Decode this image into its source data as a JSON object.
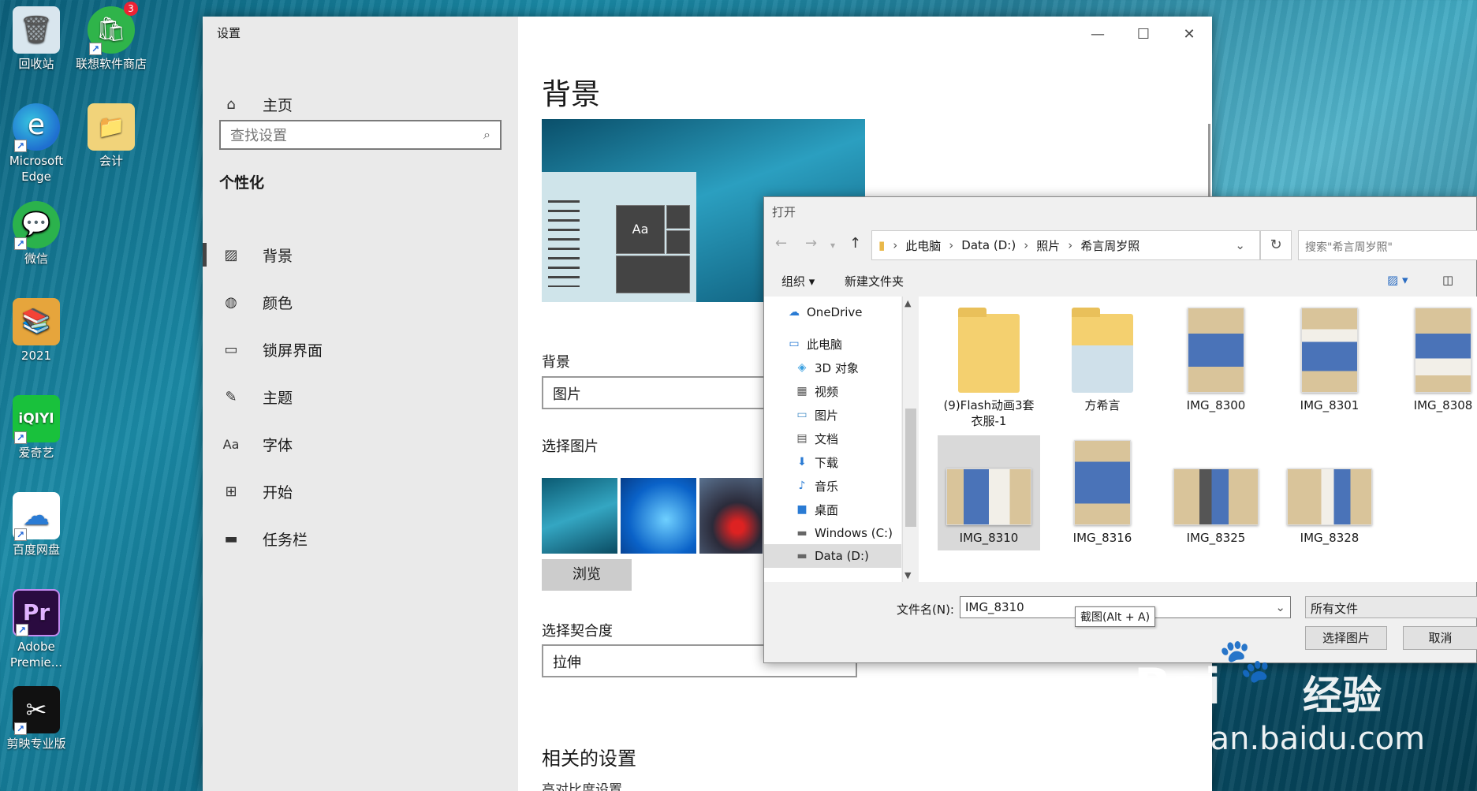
{
  "desktop": {
    "icons": [
      {
        "label": "回收站",
        "glyph": "🗑",
        "bg": "#d9e6ee"
      },
      {
        "label": "联想软件商店",
        "glyph": "🛍",
        "bg": "#2fb44a",
        "badge": "3"
      },
      {
        "label": "Microsoft Edge",
        "glyph": "e",
        "bg": "#1f8fd6"
      },
      {
        "label": "会计",
        "glyph": "📁",
        "bg": "#f1d37a"
      },
      {
        "label": "微信",
        "glyph": "💬",
        "bg": "#2bb24c"
      },
      {
        "label": "2021",
        "glyph": "📚",
        "bg": "#e6a53c"
      },
      {
        "label": "爱奇艺",
        "glyph": "iQIYI",
        "bg": "#19c13c"
      },
      {
        "label": "百度网盘",
        "glyph": "☁",
        "bg": "#ffffff"
      },
      {
        "label": "Adobe Premie...",
        "glyph": "Pr",
        "bg": "#2a0b40"
      },
      {
        "label": "剪映专业版",
        "glyph": "✂",
        "bg": "#111111"
      }
    ]
  },
  "settings": {
    "title": "设置",
    "home": "主页",
    "search_placeholder": "查找设置",
    "section": "个性化",
    "nav": [
      "背景",
      "颜色",
      "锁屏界面",
      "主题",
      "字体",
      "开始",
      "任务栏"
    ],
    "page_title": "背景",
    "preview_tile": "Aa",
    "background_label": "背景",
    "background_value": "图片",
    "choose_picture_label": "选择图片",
    "browse": "浏览",
    "fit_label": "选择契合度",
    "fit_value": "拉伸",
    "related_title": "相关的设置",
    "related_link": "高对比度设置"
  },
  "dialog": {
    "title": "打开",
    "breadcrumb": [
      "此电脑",
      "Data (D:)",
      "照片",
      "希言周岁照"
    ],
    "search_placeholder": "搜索\"希言周岁照\"",
    "organize": "组织 ▾",
    "new_folder": "新建文件夹",
    "tree": [
      {
        "label": "OneDrive",
        "icon": "☁",
        "color": "#2a7bd4"
      },
      {
        "label": "此电脑",
        "icon": "💻",
        "color": "#2a7bd4"
      },
      {
        "label": "3D 对象",
        "icon": "◈",
        "color": "#3aa0e0"
      },
      {
        "label": "视频",
        "icon": "▦",
        "color": "#555"
      },
      {
        "label": "图片",
        "icon": "▭",
        "color": "#4a90c8"
      },
      {
        "label": "文档",
        "icon": "▤",
        "color": "#555"
      },
      {
        "label": "下载",
        "icon": "⬇",
        "color": "#2a7bd4"
      },
      {
        "label": "音乐",
        "icon": "♪",
        "color": "#2a7bd4"
      },
      {
        "label": "桌面",
        "icon": "■",
        "color": "#2a7bd4"
      },
      {
        "label": "Windows (C:)",
        "icon": "▬",
        "color": "#666"
      },
      {
        "label": "Data (D:)",
        "icon": "▬",
        "color": "#666"
      }
    ],
    "files": [
      {
        "name": "(9)Flash动画3套衣服-1",
        "kind": "folder"
      },
      {
        "name": "方希言",
        "kind": "folder-photo"
      },
      {
        "name": "IMG_8300",
        "kind": "portrait"
      },
      {
        "name": "IMG_8301",
        "kind": "portrait"
      },
      {
        "name": "IMG_8308",
        "kind": "portrait"
      },
      {
        "name": "IMG_8310",
        "kind": "landscape"
      },
      {
        "name": "IMG_8316",
        "kind": "portrait"
      },
      {
        "name": "IMG_8325",
        "kind": "landscape"
      },
      {
        "name": "IMG_8328",
        "kind": "landscape"
      }
    ],
    "filename_label": "文件名(N):",
    "filename_value": "IMG_8310",
    "tooltip": "截图(Alt + A)",
    "filetype": "所有文件",
    "ok": "选择图片",
    "cancel": "取消"
  },
  "watermark": {
    "brand": "Bai",
    "brand2": "经验",
    "url": "jingyan.baidu.com"
  }
}
